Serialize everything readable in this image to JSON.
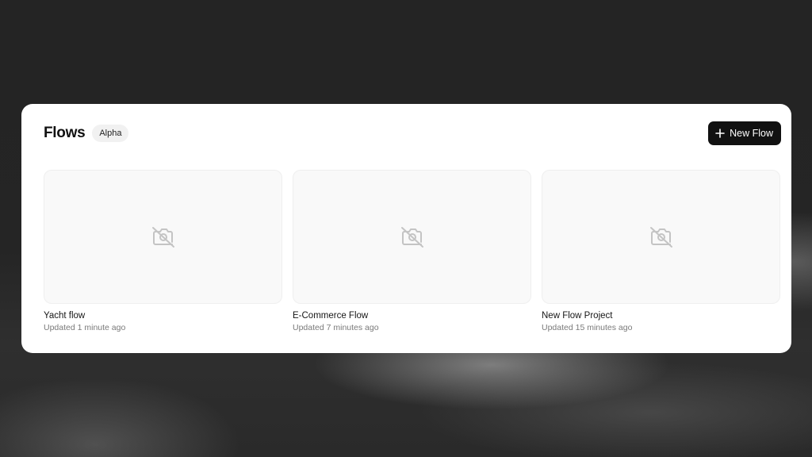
{
  "header": {
    "title": "Flows",
    "badge": "Alpha",
    "new_button_label": "New Flow",
    "new_button_icon": "plus-icon"
  },
  "flows": [
    {
      "name": "Yacht flow",
      "updated": "Updated 1 minute ago",
      "thumbnail_icon": "no-image-icon"
    },
    {
      "name": "E-Commerce Flow",
      "updated": "Updated 7 minutes ago",
      "thumbnail_icon": "no-image-icon"
    },
    {
      "name": "New Flow Project",
      "updated": "Updated 15 minutes ago",
      "thumbnail_icon": "no-image-icon"
    }
  ],
  "colors": {
    "panel_background": "#ffffff",
    "button_background": "#111111",
    "thumbnail_background": "#f9f9f9",
    "meta_text": "#7a7a7a"
  }
}
